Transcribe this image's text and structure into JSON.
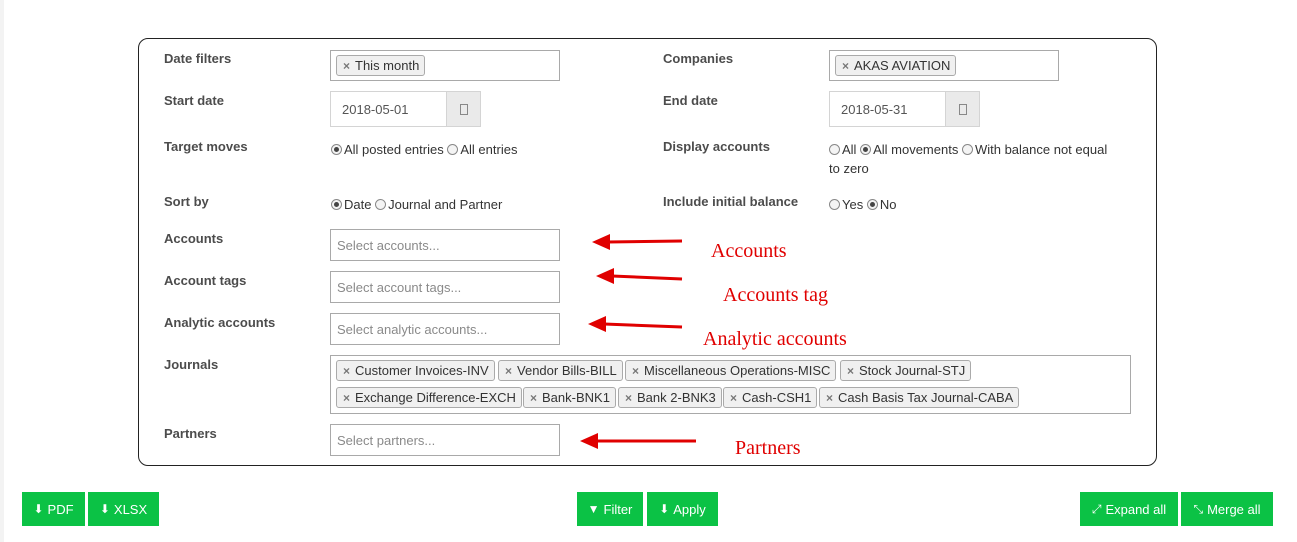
{
  "filters": {
    "date_filters": {
      "label": "Date filters",
      "tags": [
        "This month"
      ]
    },
    "companies": {
      "label": "Companies",
      "tags": [
        "AKAS AVIATION"
      ]
    },
    "start_date": {
      "label": "Start date",
      "value": "2018-05-01"
    },
    "end_date": {
      "label": "End date",
      "value": "2018-05-31"
    },
    "target_moves": {
      "label": "Target moves",
      "options": [
        "All posted entries",
        "All entries"
      ],
      "selected": "All posted entries"
    },
    "display_accounts": {
      "label": "Display accounts",
      "options": [
        "All",
        "All movements",
        "With balance not equal",
        "to zero"
      ],
      "selected": "All movements"
    },
    "sort_by": {
      "label": "Sort by",
      "options": [
        "Date",
        "Journal and Partner"
      ],
      "selected": "Date"
    },
    "initial_balance": {
      "label": "Include initial balance",
      "options": [
        "Yes",
        "No"
      ],
      "selected": "No"
    },
    "accounts": {
      "label": "Accounts",
      "placeholder": "Select accounts..."
    },
    "account_tags": {
      "label": "Account tags",
      "placeholder": "Select account tags..."
    },
    "analytic_accounts": {
      "label": "Analytic accounts",
      "placeholder": "Select analytic accounts..."
    },
    "journals": {
      "label": "Journals",
      "tags": [
        "Customer Invoices-INV",
        "Vendor Bills-BILL",
        "Miscellaneous Operations-MISC",
        "Stock Journal-STJ",
        "Exchange Difference-EXCH",
        "Bank-BNK1",
        "Bank 2-BNK3",
        "Cash-CSH1",
        "Cash Basis Tax Journal-CABA"
      ]
    },
    "partners": {
      "label": "Partners",
      "placeholder": "Select partners..."
    }
  },
  "annotations": [
    "Accounts",
    "Accounts tag",
    "Analytic accounts",
    "Partners"
  ],
  "annotation_color": "#e00000",
  "buttons": {
    "pdf": "PDF",
    "xlsx": "XLSX",
    "filter": "Filter",
    "apply": "Apply",
    "expand": "Expand all",
    "merge": "Merge all"
  },
  "button_color": "#0bc245"
}
